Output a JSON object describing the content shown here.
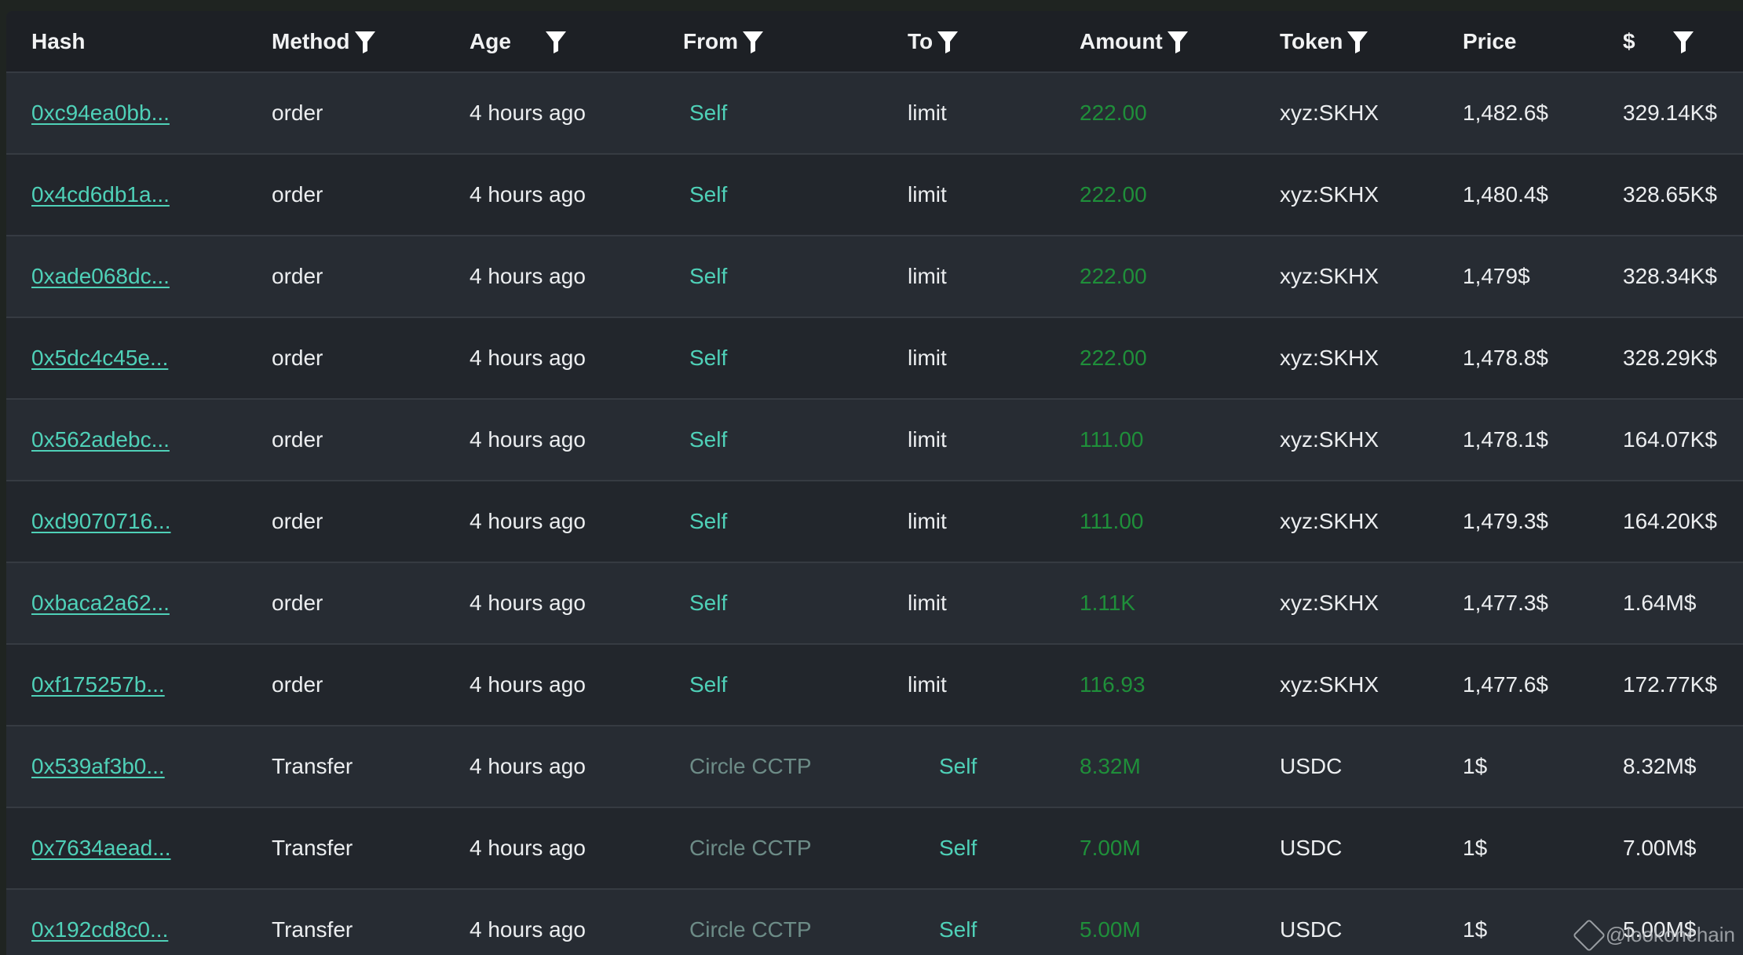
{
  "columns": {
    "hash": "Hash",
    "method": "Method",
    "age": "Age",
    "from": "From",
    "to": "To",
    "amount": "Amount",
    "token": "Token",
    "price": "Price",
    "usd": "$"
  },
  "rows": [
    {
      "hash": "0xc94ea0bb...",
      "method": "order",
      "age": "4 hours ago",
      "from": "Self",
      "to": "limit",
      "amount": "222.00",
      "token": "xyz:SKHX",
      "price": "1,482.6$",
      "usd": "329.14K$"
    },
    {
      "hash": "0x4cd6db1a...",
      "method": "order",
      "age": "4 hours ago",
      "from": "Self",
      "to": "limit",
      "amount": "222.00",
      "token": "xyz:SKHX",
      "price": "1,480.4$",
      "usd": "328.65K$"
    },
    {
      "hash": "0xade068dc...",
      "method": "order",
      "age": "4 hours ago",
      "from": "Self",
      "to": "limit",
      "amount": "222.00",
      "token": "xyz:SKHX",
      "price": "1,479$",
      "usd": "328.34K$"
    },
    {
      "hash": "0x5dc4c45e...",
      "method": "order",
      "age": "4 hours ago",
      "from": "Self",
      "to": "limit",
      "amount": "222.00",
      "token": "xyz:SKHX",
      "price": "1,478.8$",
      "usd": "328.29K$"
    },
    {
      "hash": "0x562adebc...",
      "method": "order",
      "age": "4 hours ago",
      "from": "Self",
      "to": "limit",
      "amount": "111.00",
      "token": "xyz:SKHX",
      "price": "1,478.1$",
      "usd": "164.07K$"
    },
    {
      "hash": "0xd9070716...",
      "method": "order",
      "age": "4 hours ago",
      "from": "Self",
      "to": "limit",
      "amount": "111.00",
      "token": "xyz:SKHX",
      "price": "1,479.3$",
      "usd": "164.20K$"
    },
    {
      "hash": "0xbaca2a62...",
      "method": "order",
      "age": "4 hours ago",
      "from": "Self",
      "to": "limit",
      "amount": "1.11K",
      "token": "xyz:SKHX",
      "price": "1,477.3$",
      "usd": "1.64M$"
    },
    {
      "hash": "0xf175257b...",
      "method": "order",
      "age": "4 hours ago",
      "from": "Self",
      "to": "limit",
      "amount": "116.93",
      "token": "xyz:SKHX",
      "price": "1,477.6$",
      "usd": "172.77K$"
    },
    {
      "hash": "0x539af3b0...",
      "method": "Transfer",
      "age": "4 hours ago",
      "from": "Circle CCTP",
      "to": "Self",
      "amount": "8.32M",
      "token": "USDC",
      "price": "1$",
      "usd": "8.32M$"
    },
    {
      "hash": "0x7634aead...",
      "method": "Transfer",
      "age": "4 hours ago",
      "from": "Circle CCTP",
      "to": "Self",
      "amount": "7.00M",
      "token": "USDC",
      "price": "1$",
      "usd": "7.00M$"
    },
    {
      "hash": "0x192cd8c0...",
      "method": "Transfer",
      "age": "4 hours ago",
      "from": "Circle CCTP",
      "to": "Self",
      "amount": "5.00M",
      "token": "USDC",
      "price": "1$",
      "usd": "5.00M$"
    }
  ],
  "watermark": "@lookonchain",
  "icons": {
    "filter": "filter-icon",
    "watermark": "lookonchain-logo-icon"
  },
  "colors": {
    "link": "#4fd1b8",
    "amount": "#1f8f3a",
    "muted_link": "#6d8c87"
  }
}
